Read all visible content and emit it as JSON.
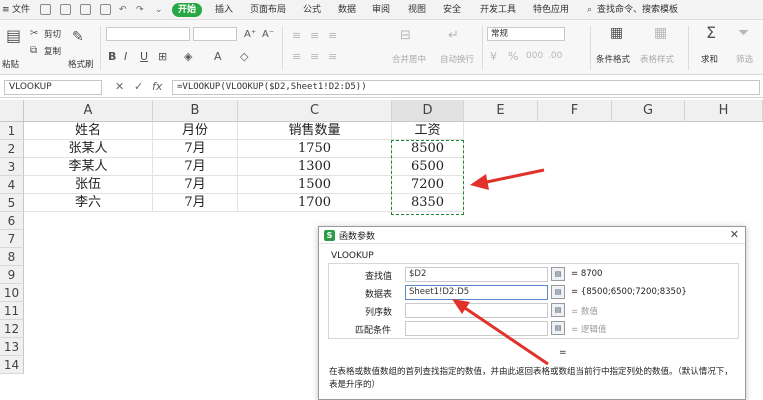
{
  "menu": {
    "file": "文件",
    "tabs": [
      "开始",
      "插入",
      "页面布局",
      "公式",
      "数据",
      "审阅",
      "视图",
      "安全",
      "开发工具",
      "特色应用"
    ],
    "search": "查找命令、搜索模板"
  },
  "ribbon": {
    "paste": "粘贴",
    "cut": "剪切",
    "copy": "复制",
    "format_painter": "格式刷",
    "merge_center": "合并居中",
    "auto_wrap": "自动换行",
    "number_format": "常规",
    "conditional_format": "条件格式",
    "table_style": "表格样式",
    "sum": "求和",
    "filter": "筛选"
  },
  "formula_bar": {
    "name_box": "VLOOKUP",
    "cancel": "✕",
    "confirm": "✓",
    "fx": "fx",
    "formula": "=VLOOKUP(VLOOKUP($D2,Sheet1!D2:D5))"
  },
  "columns": [
    "A",
    "B",
    "C",
    "D",
    "E",
    "F",
    "G",
    "H"
  ],
  "rows": [
    "1",
    "2",
    "3",
    "4",
    "5",
    "6",
    "7",
    "8",
    "9",
    "10",
    "11",
    "12",
    "13",
    "14"
  ],
  "table": [
    [
      "姓名",
      "月份",
      "销售数量",
      "工资"
    ],
    [
      "张某人",
      "7月",
      "1750",
      "8500"
    ],
    [
      "李某人",
      "7月",
      "1300",
      "6500"
    ],
    [
      "张伍",
      "7月",
      "1500",
      "7200"
    ],
    [
      "李六",
      "7月",
      "1700",
      "8350"
    ]
  ],
  "dialog": {
    "title": "函数参数",
    "close": "✕",
    "function_name": "VLOOKUP",
    "args": [
      {
        "label": "查找值",
        "value": "$D2",
        "result": "= 8700",
        "placeholder": false
      },
      {
        "label": "数据表",
        "value": "Sheet1!D2:D5",
        "result": "= {8500;6500;7200;8350}",
        "placeholder": false
      },
      {
        "label": "列序数",
        "value": "",
        "result": "= 数值",
        "placeholder": true
      },
      {
        "label": "匹配条件",
        "value": "",
        "result": "= 逻辑值",
        "placeholder": true
      }
    ],
    "equals": "=",
    "description": "在表格或数值数组的首列查找指定的数值，并由此返回表格或数组当前行中指定列处的数值。（默认情况下，表是升序的）"
  },
  "colors": {
    "accent_green": "#28a745",
    "arrow_red": "#e0322a",
    "marquee_green": "#1e8a2e"
  }
}
